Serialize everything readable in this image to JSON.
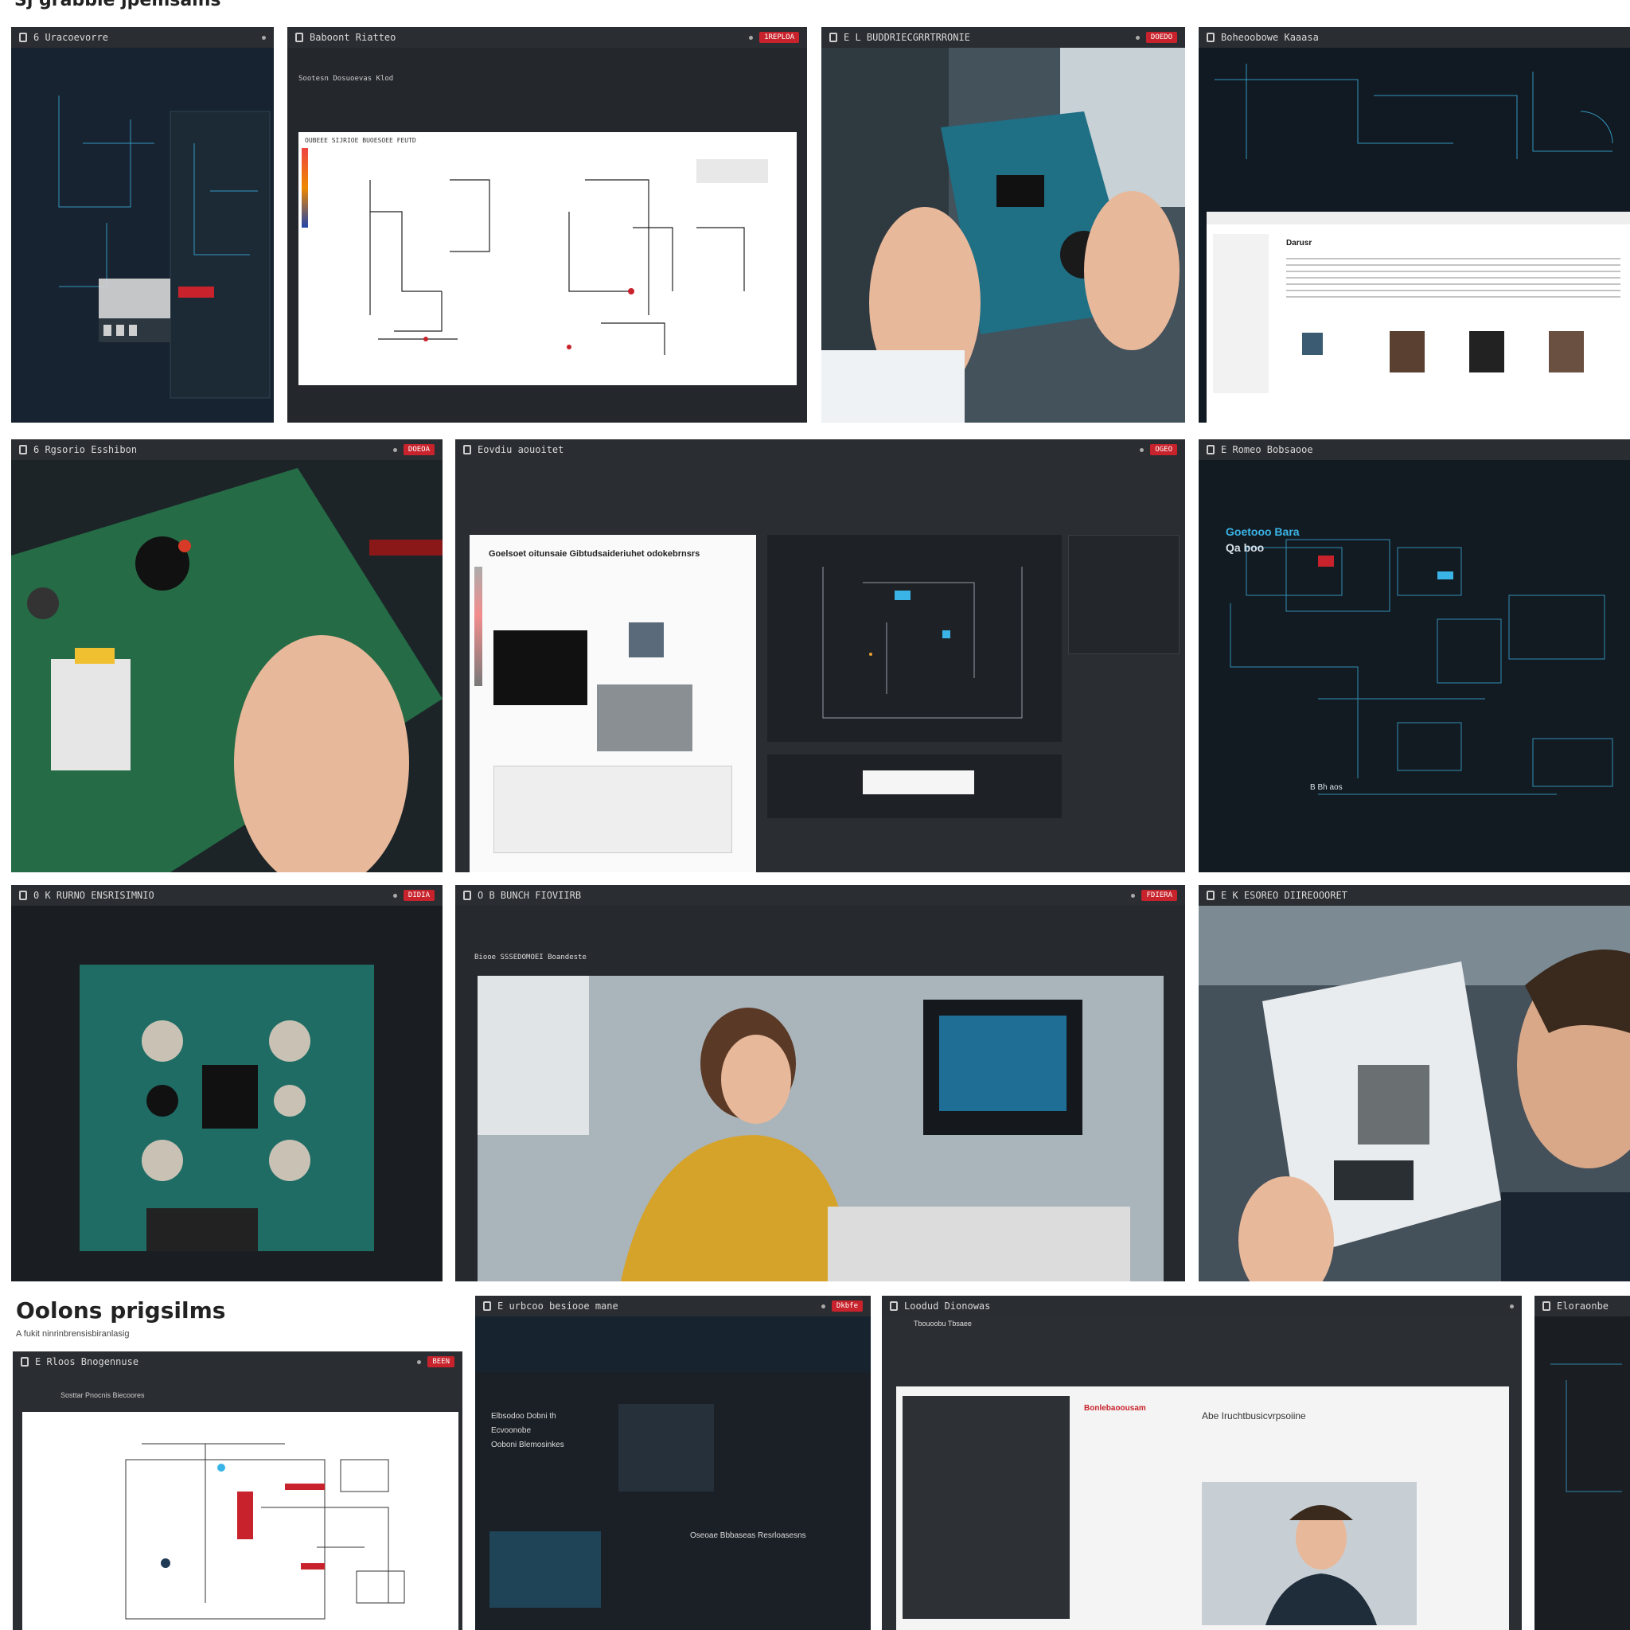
{
  "sections": {
    "top_title": "Sj grabble jpemsains",
    "bottom_title": "Oolons prigsilms",
    "bottom_subtitle": "A fukit ninrinbrensisbiranlasig"
  },
  "tiles": [
    {
      "title": "6 Uracoevorre"
    },
    {
      "title": "Baboont Riatteo",
      "button": "1REPLOA",
      "tabs": "Sootesn Dosuoevas Klod",
      "doc_heading": "OUBEEE SIJRIOE BUOESOEE FEUTD"
    },
    {
      "title": "E L BUDDRIECGRRTRRONIE",
      "button": "DOEDO"
    },
    {
      "title": "Boheoobowe Kaaasa",
      "panel_heading": "Darusr"
    },
    {
      "title": "6 Rgsorio Esshibon",
      "button": "DOEOA"
    },
    {
      "title": "Eovdiu aouoitet",
      "button": "OGEO",
      "heading": "Goelsoet oitunsaie Gibtudsaideriuhet odokebrnsrs"
    },
    {
      "title": "E Romeo Bobsaooe",
      "overlay_label_1": "Goetooo Bara",
      "overlay_label_2": "Qa boo",
      "overlay_label_3": "B Bh aos"
    },
    {
      "title": "0 K RURNO ENSRISIMNIO",
      "button": "DIDIA"
    },
    {
      "title": "O B BUNCH FIOVIIRB",
      "button": "FDIERA",
      "heading": "Biooe SSSEDOMOEI Boandeste"
    },
    {
      "title": "E K ESOREO DIIREOOORET"
    },
    {
      "title": "E Rloos Bnogennuse",
      "button": "BEEN",
      "tabs": "Sosttar Pnocnis Biecoores"
    },
    {
      "title": "E urbcoo besiooe mane",
      "button": "Dkbfe",
      "menu_1": "Elbsodoo Dobni th",
      "menu_2": "Ecvoonobe",
      "menu_3": "Ooboni Blemosinkes",
      "list_heading": "Oseoae Bbbaseas Resrloasesns"
    },
    {
      "title": "Loodud Dionowas",
      "sub": "Tbouoobu Tbsaee",
      "heading": "Abe Iruchtbusicvrpsoiine",
      "user": "Bonlebaoousam"
    },
    {
      "title": "Eloraonbe"
    }
  ],
  "colors": {
    "accent_red": "#c8232c",
    "accent_cyan": "#3ab4e6",
    "dark_bg": "#1d2228"
  }
}
